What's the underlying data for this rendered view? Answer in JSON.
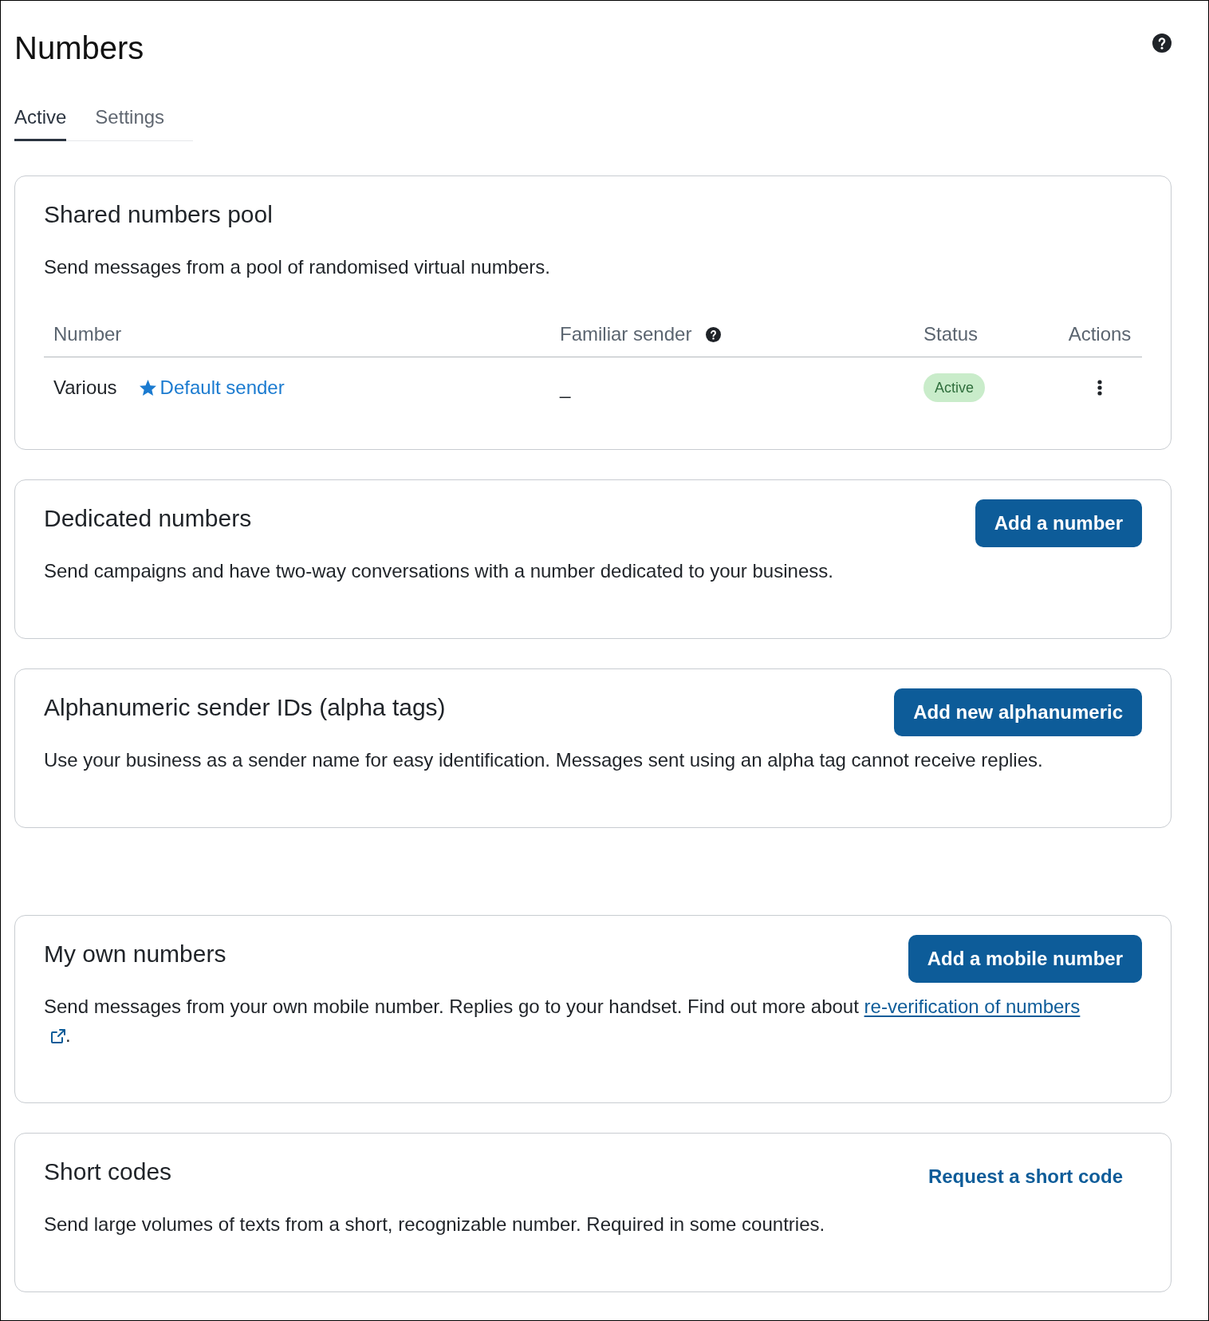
{
  "page": {
    "title": "Numbers"
  },
  "tabs": [
    {
      "label": "Active",
      "selected": true
    },
    {
      "label": "Settings",
      "selected": false
    }
  ],
  "sections": [
    {
      "kind": "table",
      "title": "Shared numbers pool",
      "description": "Send messages from a pool of randomised virtual numbers.",
      "table": {
        "columns": [
          {
            "label": "Number",
            "help": false
          },
          {
            "label": "Familiar sender",
            "help": true
          },
          {
            "label": "Status",
            "help": false
          },
          {
            "label": "Actions",
            "help": false
          }
        ],
        "rows": [
          {
            "number": "Various",
            "default_sender": "Default sender",
            "familiar_sender": "_",
            "status": "Active"
          }
        ]
      }
    },
    {
      "kind": "info",
      "title": "Dedicated numbers",
      "description": "Send campaigns and have two-way conversations with a number dedicated to your business.",
      "action": {
        "kind": "button",
        "label": "Add a number"
      }
    },
    {
      "kind": "info",
      "title": "Alphanumeric sender IDs (alpha tags)",
      "description": "Use your business as a sender name for easy identification. Messages sent using an alpha tag cannot receive replies.",
      "action": {
        "kind": "button",
        "label": "Add new alphanumeric"
      }
    },
    {
      "kind": "info",
      "title": "My own numbers",
      "description": "Send messages from your own mobile number. Replies go to your handset. Find out more about",
      "link": {
        "label": "re-verification of numbers",
        "external": true
      },
      "description_end": ".",
      "action": {
        "kind": "button",
        "label": "Add a mobile number"
      }
    },
    {
      "kind": "info",
      "title": "Short codes",
      "description": "Send large volumes of texts from a short, recognizable number. Required in some countries.",
      "action": {
        "kind": "link",
        "label": "Request a short code"
      }
    }
  ]
}
